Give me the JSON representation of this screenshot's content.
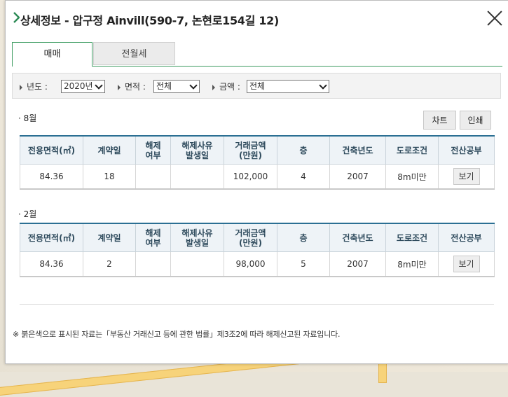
{
  "title": "상세정보 - 압구정 Ainvill(590-7, 논현로154길 12)",
  "tabs": [
    {
      "label": "매매"
    },
    {
      "label": "전월세"
    }
  ],
  "filters": {
    "year_label": "년도 :",
    "year_value": "2020년",
    "area_label": "면적 :",
    "area_value": "전체",
    "price_label": "금액 :",
    "price_value": "전체"
  },
  "buttons": {
    "chart": "차트",
    "print": "인쇄"
  },
  "columns": [
    "전용면적(㎡)",
    "계약일",
    "해제\n여부",
    "해제사유\n발생일",
    "거래금액\n(만원)",
    "층",
    "건축년도",
    "도로조건",
    "전산공부"
  ],
  "sections": [
    {
      "month": "· 8월",
      "row": {
        "area": "84.36",
        "day": "18",
        "cancel": "",
        "cancel_date": "",
        "price": "102,000",
        "floor": "4",
        "built": "2007",
        "road": "8m미만",
        "doc": "보기"
      }
    },
    {
      "month": "· 2월",
      "row": {
        "area": "84.36",
        "day": "2",
        "cancel": "",
        "cancel_date": "",
        "price": "98,000",
        "floor": "5",
        "built": "2007",
        "road": "8m미만",
        "doc": "보기"
      }
    }
  ],
  "note": "※ 붉은색으로 표시된 자료는「부동산 거래신고 등에 관한 법률」제3조2에 따라 해제신고된 자료입니다.",
  "colors": {
    "accent_green": "#3e9c62",
    "table_top": "#2b6f93",
    "header_bg": "#eef3f7"
  },
  "icons": {
    "title": "chevron-right-icon",
    "close": "close-icon"
  }
}
